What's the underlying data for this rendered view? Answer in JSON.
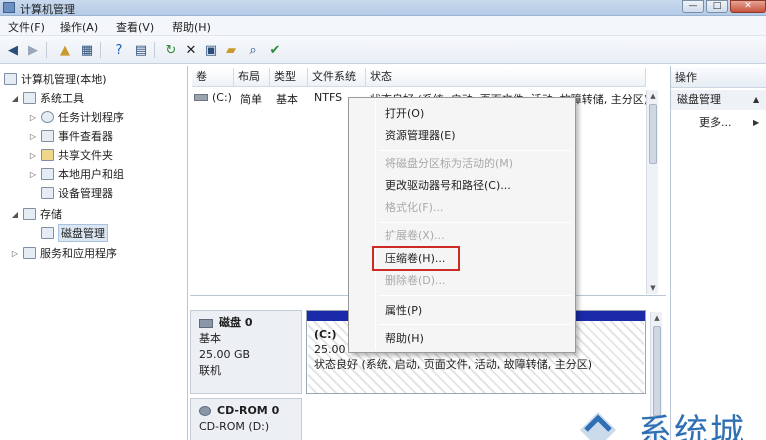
{
  "window": {
    "title": "计算机管理",
    "buttons": {
      "minimize": "—",
      "maximize": "□",
      "close": "✕"
    }
  },
  "menubar": {
    "items": [
      "文件(F)",
      "操作(A)",
      "查看(V)",
      "帮助(H)"
    ]
  },
  "toolbar": {
    "icons": [
      "back-arrow-icon",
      "forward-arrow-icon",
      "up-folder-icon",
      "show-hide-tree-icon",
      "help-book-icon",
      "console-icon",
      "refresh-icon",
      "delete-x-icon",
      "properties-icon",
      "open-folder-icon",
      "search-icon",
      "check-icon"
    ]
  },
  "tree": {
    "items": [
      {
        "label": "计算机管理(本地)",
        "expander": ""
      },
      {
        "label": "系统工具",
        "expander": "◢"
      },
      {
        "label": "任务计划程序",
        "expander": "▷"
      },
      {
        "label": "事件查看器",
        "expander": "▷"
      },
      {
        "label": "共享文件夹",
        "expander": "▷"
      },
      {
        "label": "本地用户和组",
        "expander": "▷"
      },
      {
        "label": "设备管理器",
        "expander": ""
      },
      {
        "label": "存储",
        "expander": "◢"
      },
      {
        "label": "磁盘管理",
        "expander": ""
      },
      {
        "label": "服务和应用程序",
        "expander": "▷"
      }
    ],
    "selected_index": 8
  },
  "volume_list": {
    "columns": [
      "卷",
      "布局",
      "类型",
      "文件系统",
      "状态"
    ],
    "rows": [
      {
        "volume": "(C:)",
        "layout": "简单",
        "type": "基本",
        "filesystem": "NTFS",
        "status": "状态良好 (系统, 启动, 页面文件, 活动, 故障转储, 主分区)"
      }
    ]
  },
  "context_menu": {
    "items": [
      {
        "label": "打开(O)",
        "enabled": true
      },
      {
        "label": "资源管理器(E)",
        "enabled": true
      },
      {
        "label": "将磁盘分区标为活动的(M)",
        "enabled": false
      },
      {
        "label": "更改驱动器号和路径(C)...",
        "enabled": true
      },
      {
        "label": "格式化(F)...",
        "enabled": false
      },
      {
        "label": "扩展卷(X)...",
        "enabled": false
      },
      {
        "label": "压缩卷(H)...",
        "enabled": true
      },
      {
        "label": "删除卷(D)...",
        "enabled": false
      },
      {
        "label": "属性(P)",
        "enabled": true
      },
      {
        "label": "帮助(H)",
        "enabled": true
      }
    ],
    "highlighted_item": "压缩卷(H)..."
  },
  "disks": [
    {
      "name": "磁盘 0",
      "kind": "基本",
      "size": "25.00 GB",
      "state": "联机",
      "partition": {
        "label": "(C:)",
        "size_fs": "25.00 GB NTFS",
        "status": "状态良好 (系统, 启动, 页面文件, 活动, 故障转储, 主分区)"
      }
    },
    {
      "name": "CD-ROM 0",
      "drive": "CD-ROM (D:)"
    }
  ],
  "actions": {
    "header": "操作",
    "section": "磁盘管理",
    "more": "更多..."
  },
  "watermark": {
    "text": "系统城"
  },
  "colors": {
    "partition_bar": "#1a2aa8",
    "highlight_border": "#cc2b24",
    "watermark": "#2f6fb3"
  }
}
